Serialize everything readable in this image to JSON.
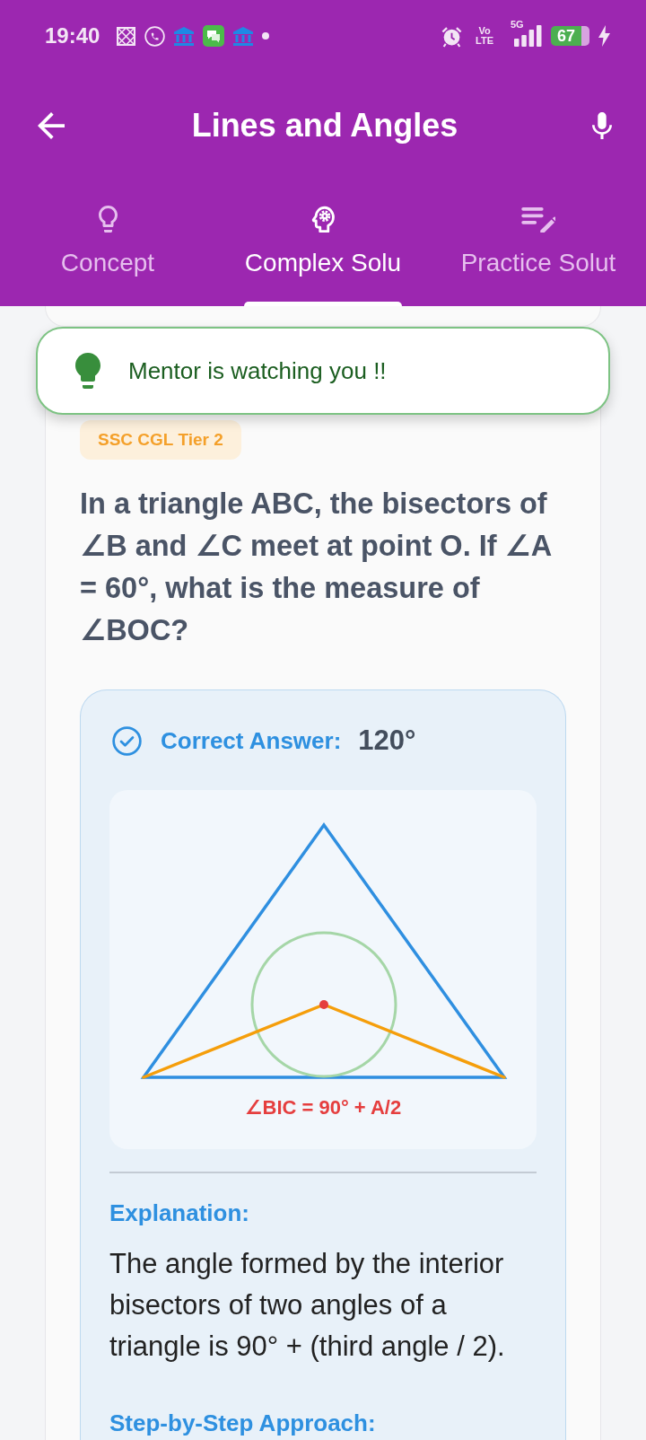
{
  "status_bar": {
    "time": "19:40",
    "volte": "Vo LTE",
    "network": "5G",
    "battery": "67"
  },
  "app_bar": {
    "title": "Lines and Angles"
  },
  "tabs": [
    {
      "label": "Concept",
      "selected": false
    },
    {
      "label": "Complex Solu",
      "selected": true
    },
    {
      "label": "Practice Solut",
      "selected": false
    }
  ],
  "toast": {
    "message": "Mentor is watching you !!"
  },
  "question": {
    "tag": "SSC CGL Tier 2",
    "text": "In a triangle ABC, the bisectors of ∠B and ∠C meet at point O. If ∠A = 60°, what is the measure of ∠BOC?"
  },
  "answer": {
    "label": "Correct Answer:",
    "value": "120°",
    "diagram_caption": "∠BIC = 90° + A/2",
    "explanation_heading": "Explanation:",
    "explanation": "The angle formed by the interior bisectors of two angles of a triangle is 90° + (third angle / 2).",
    "steps_heading": "Step-by-Step Approach:"
  }
}
